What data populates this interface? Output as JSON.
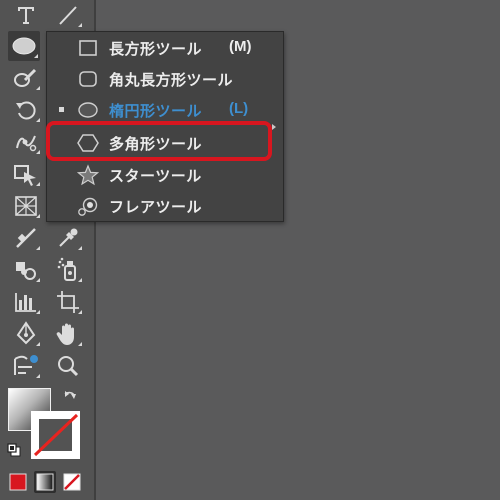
{
  "flyout_menu": {
    "items": [
      {
        "label": "長方形ツール",
        "shortcut": "(M)",
        "icon": "rectangle-icon"
      },
      {
        "label": "角丸長方形ツール",
        "shortcut": "",
        "icon": "rounded-rectangle-icon"
      },
      {
        "label": "楕円形ツール",
        "shortcut": "(L)",
        "icon": "ellipse-icon",
        "current": true
      },
      {
        "label": "多角形ツール",
        "shortcut": "",
        "icon": "polygon-icon",
        "highlighted": true
      },
      {
        "label": "スターツール",
        "shortcut": "",
        "icon": "star-icon"
      },
      {
        "label": "フレアツール",
        "shortcut": "",
        "icon": "flare-icon"
      }
    ]
  },
  "colors": {
    "highlight_outline": "#d8161f",
    "current_item_text": "#3e8fd0",
    "toolbar_bg": "#535353",
    "canvas_bg": "#5a5a5b",
    "flyout_bg": "#434343"
  },
  "toolbar": {
    "tools": [
      "type-icon",
      "line-segment-icon",
      "ellipse-tool-icon",
      "paintbrush-icon",
      "rotate-icon",
      "puppet-warp-icon",
      "free-transform-icon",
      "perspective-grid-icon",
      "gradient-icon",
      "eyedropper-icon",
      "blend-icon",
      "symbol-sprayer-icon",
      "bar-graph-icon",
      "artboard-icon",
      "pen-icon",
      "hand-icon",
      "shape-builder-icon",
      "zoom-icon"
    ],
    "active_tool": "ellipse-tool-icon",
    "fill_stroke": {
      "fill": "gradient",
      "stroke": "none",
      "swap_icon": "swap-arrow-icon",
      "default_icon": "default-colors-icon"
    },
    "color_modes": [
      "color-icon",
      "gradient-mode-icon",
      "none-icon"
    ]
  }
}
